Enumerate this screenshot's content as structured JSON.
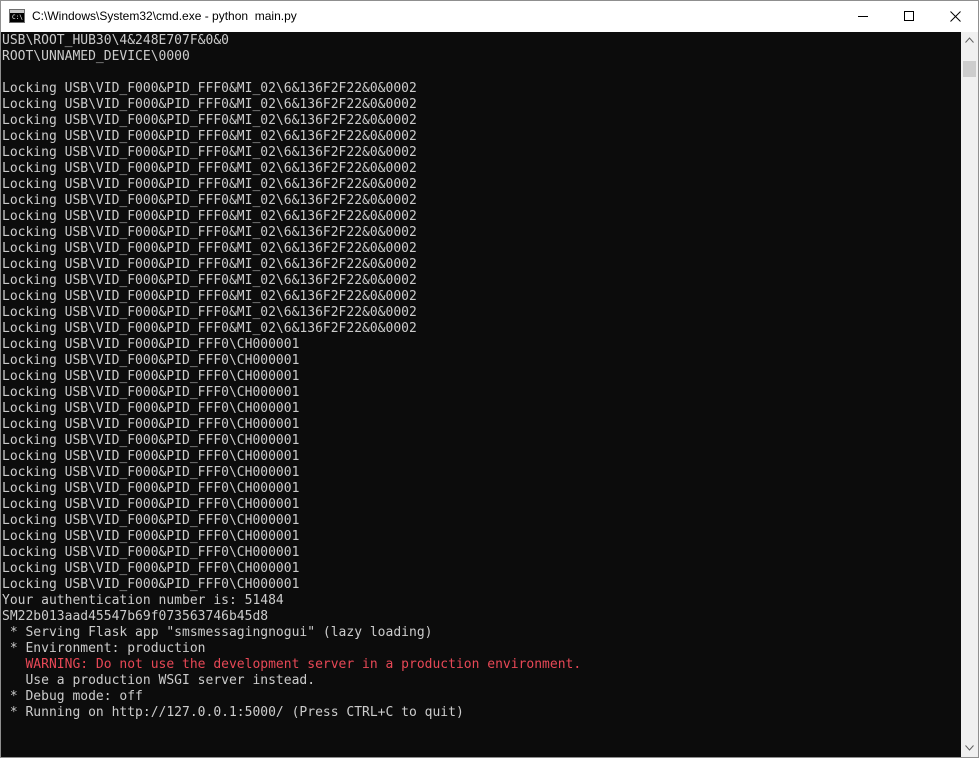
{
  "window": {
    "title": "C:\\Windows\\System32\\cmd.exe - python  main.py",
    "icon": "cmd-icon",
    "controls": [
      "minimize-icon",
      "maximize-icon",
      "close-icon"
    ]
  },
  "colors": {
    "console_bg": "#0c0c0c",
    "console_text": "#cccccc",
    "warning_text": "#e74856"
  },
  "console": {
    "lines": [
      {
        "text": "USB\\ROOT_HUB30\\4&248E707F&0&0",
        "kind": "normal"
      },
      {
        "text": "ROOT\\UNNAMED_DEVICE\\0000",
        "kind": "normal"
      },
      {
        "text": "",
        "kind": "normal"
      },
      {
        "text": "Locking USB\\VID_F000&PID_FFF0&MI_02\\6&136F2F22&0&0002",
        "kind": "normal"
      },
      {
        "text": "Locking USB\\VID_F000&PID_FFF0&MI_02\\6&136F2F22&0&0002",
        "kind": "normal"
      },
      {
        "text": "Locking USB\\VID_F000&PID_FFF0&MI_02\\6&136F2F22&0&0002",
        "kind": "normal"
      },
      {
        "text": "Locking USB\\VID_F000&PID_FFF0&MI_02\\6&136F2F22&0&0002",
        "kind": "normal"
      },
      {
        "text": "Locking USB\\VID_F000&PID_FFF0&MI_02\\6&136F2F22&0&0002",
        "kind": "normal"
      },
      {
        "text": "Locking USB\\VID_F000&PID_FFF0&MI_02\\6&136F2F22&0&0002",
        "kind": "normal"
      },
      {
        "text": "Locking USB\\VID_F000&PID_FFF0&MI_02\\6&136F2F22&0&0002",
        "kind": "normal"
      },
      {
        "text": "Locking USB\\VID_F000&PID_FFF0&MI_02\\6&136F2F22&0&0002",
        "kind": "normal"
      },
      {
        "text": "Locking USB\\VID_F000&PID_FFF0&MI_02\\6&136F2F22&0&0002",
        "kind": "normal"
      },
      {
        "text": "Locking USB\\VID_F000&PID_FFF0&MI_02\\6&136F2F22&0&0002",
        "kind": "normal"
      },
      {
        "text": "Locking USB\\VID_F000&PID_FFF0&MI_02\\6&136F2F22&0&0002",
        "kind": "normal"
      },
      {
        "text": "Locking USB\\VID_F000&PID_FFF0&MI_02\\6&136F2F22&0&0002",
        "kind": "normal"
      },
      {
        "text": "Locking USB\\VID_F000&PID_FFF0&MI_02\\6&136F2F22&0&0002",
        "kind": "normal"
      },
      {
        "text": "Locking USB\\VID_F000&PID_FFF0&MI_02\\6&136F2F22&0&0002",
        "kind": "normal"
      },
      {
        "text": "Locking USB\\VID_F000&PID_FFF0&MI_02\\6&136F2F22&0&0002",
        "kind": "normal"
      },
      {
        "text": "Locking USB\\VID_F000&PID_FFF0&MI_02\\6&136F2F22&0&0002",
        "kind": "normal"
      },
      {
        "text": "Locking USB\\VID_F000&PID_FFF0\\CH000001",
        "kind": "normal"
      },
      {
        "text": "Locking USB\\VID_F000&PID_FFF0\\CH000001",
        "kind": "normal"
      },
      {
        "text": "Locking USB\\VID_F000&PID_FFF0\\CH000001",
        "kind": "normal"
      },
      {
        "text": "Locking USB\\VID_F000&PID_FFF0\\CH000001",
        "kind": "normal"
      },
      {
        "text": "Locking USB\\VID_F000&PID_FFF0\\CH000001",
        "kind": "normal"
      },
      {
        "text": "Locking USB\\VID_F000&PID_FFF0\\CH000001",
        "kind": "normal"
      },
      {
        "text": "Locking USB\\VID_F000&PID_FFF0\\CH000001",
        "kind": "normal"
      },
      {
        "text": "Locking USB\\VID_F000&PID_FFF0\\CH000001",
        "kind": "normal"
      },
      {
        "text": "Locking USB\\VID_F000&PID_FFF0\\CH000001",
        "kind": "normal"
      },
      {
        "text": "Locking USB\\VID_F000&PID_FFF0\\CH000001",
        "kind": "normal"
      },
      {
        "text": "Locking USB\\VID_F000&PID_FFF0\\CH000001",
        "kind": "normal"
      },
      {
        "text": "Locking USB\\VID_F000&PID_FFF0\\CH000001",
        "kind": "normal"
      },
      {
        "text": "Locking USB\\VID_F000&PID_FFF0\\CH000001",
        "kind": "normal"
      },
      {
        "text": "Locking USB\\VID_F000&PID_FFF0\\CH000001",
        "kind": "normal"
      },
      {
        "text": "Locking USB\\VID_F000&PID_FFF0\\CH000001",
        "kind": "normal"
      },
      {
        "text": "Locking USB\\VID_F000&PID_FFF0\\CH000001",
        "kind": "normal"
      },
      {
        "text": "Your authentication number is: 51484",
        "kind": "normal"
      },
      {
        "text": "SM22b013aad45547b69f073563746b45d8",
        "kind": "normal"
      },
      {
        "text": " * Serving Flask app \"smsmessagingnogui\" (lazy loading)",
        "kind": "normal"
      },
      {
        "text": " * Environment: production",
        "kind": "normal"
      },
      {
        "text": "   WARNING: Do not use the development server in a production environment.",
        "kind": "warn"
      },
      {
        "text": "   Use a production WSGI server instead.",
        "kind": "normal"
      },
      {
        "text": " * Debug mode: off",
        "kind": "normal"
      },
      {
        "text": " * Running on http://127.0.0.1:5000/ (Press CTRL+C to quit)",
        "kind": "normal"
      }
    ]
  }
}
